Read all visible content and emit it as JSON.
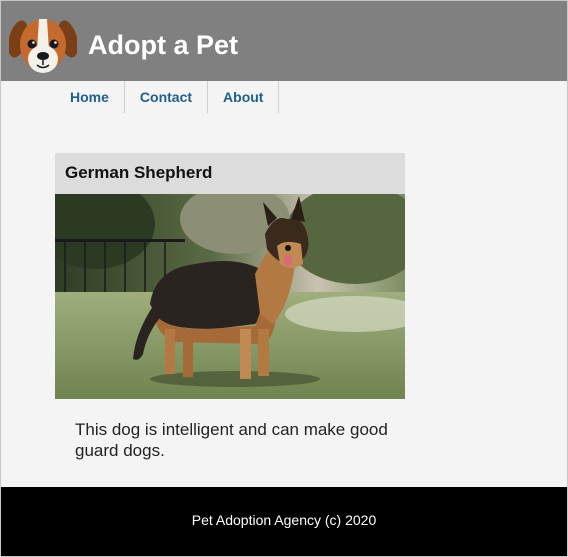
{
  "header": {
    "title": "Adopt a Pet",
    "logo_icon": "dog-face-icon",
    "background": "#808080"
  },
  "nav": {
    "items": [
      {
        "label": "Home"
      },
      {
        "label": "Contact"
      },
      {
        "label": "About"
      }
    ],
    "link_color": "#1f5f8b"
  },
  "pet_card": {
    "name": "German Shepherd",
    "photo_icon": "german-shepherd-photo",
    "description": "This dog is intelligent and can make good guard dogs."
  },
  "footer": {
    "text": "Pet Adoption Agency (c) 2020"
  }
}
